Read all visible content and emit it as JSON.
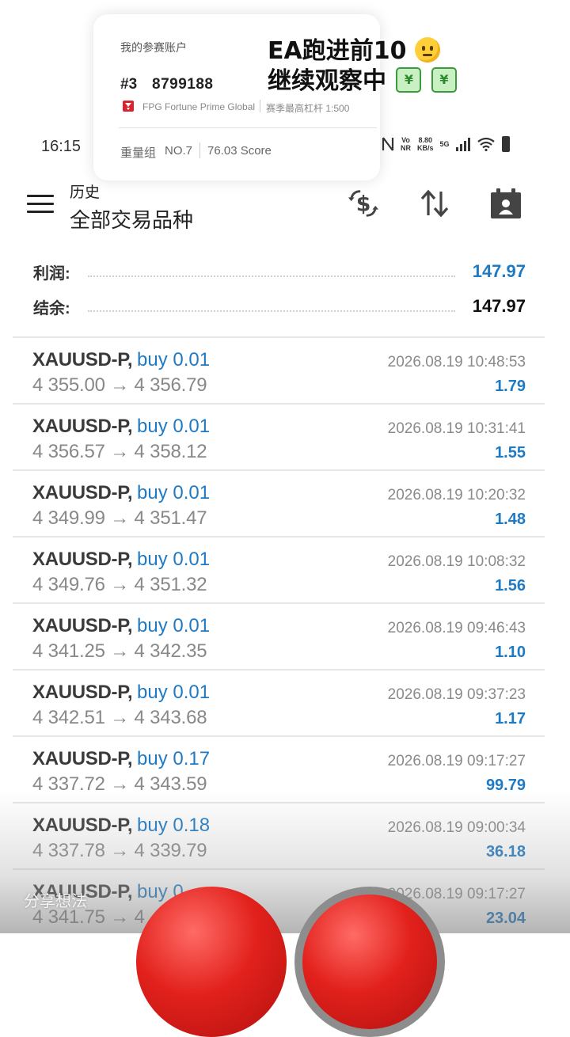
{
  "overlay_card": {
    "label": "我的参赛账户",
    "rank": "#3",
    "account": "8799188",
    "broker": "FPG Fortune Prime Global",
    "leverage": "赛季最高杠杆 1:500",
    "group": "重量组",
    "group_no": "NO.7",
    "score": "76.03 Score"
  },
  "caption": {
    "line1": "EA跑进前10",
    "line2": "继续观察中",
    "chart_glyph": "¥",
    "emoji_face": "saluting-face-icon",
    "emoji_chart": "chart-yen-icon"
  },
  "status_bar": {
    "time": "16:15",
    "net_top": "Vo",
    "net_bottom": "NR",
    "speed_top": "8.80",
    "speed_bottom": "KB/s",
    "network": "5G"
  },
  "header": {
    "subtitle": "历史",
    "title": "全部交易品种",
    "icons": [
      "currency-exchange-icon",
      "sort-icon",
      "calendar-icon"
    ]
  },
  "summary": {
    "profit_label": "利润:",
    "profit_value": "147.97",
    "balance_label": "结余:",
    "balance_value": "147.97",
    "colors": {
      "profit": "#1f7ac4",
      "balance": "#111111"
    }
  },
  "trades": [
    {
      "symbol": "XAUUSD-P,",
      "side": "buy 0.01",
      "prices": "4 355.00 → 4 356.79",
      "time": "2026.08.19 10:48:53",
      "profit": "1.79"
    },
    {
      "symbol": "XAUUSD-P,",
      "side": "buy 0.01",
      "prices": "4 356.57 → 4 358.12",
      "time": "2026.08.19 10:31:41",
      "profit": "1.55"
    },
    {
      "symbol": "XAUUSD-P,",
      "side": "buy 0.01",
      "prices": "4 349.99 → 4 351.47",
      "time": "2026.08.19 10:20:32",
      "profit": "1.48"
    },
    {
      "symbol": "XAUUSD-P,",
      "side": "buy 0.01",
      "prices": "4 349.76 → 4 351.32",
      "time": "2026.08.19 10:08:32",
      "profit": "1.56"
    },
    {
      "symbol": "XAUUSD-P,",
      "side": "buy 0.01",
      "prices": "4 341.25 → 4 342.35",
      "time": "2026.08.19 09:46:43",
      "profit": "1.10"
    },
    {
      "symbol": "XAUUSD-P,",
      "side": "buy 0.01",
      "prices": "4 342.51 → 4 343.68",
      "time": "2026.08.19 09:37:23",
      "profit": "1.17"
    },
    {
      "symbol": "XAUUSD-P,",
      "side": "buy 0.17",
      "prices": "4 337.72 → 4 343.59",
      "time": "2026.08.19 09:17:27",
      "profit": "99.79"
    },
    {
      "symbol": "XAUUSD-P,",
      "side": "buy 0.18",
      "prices": "4 337.78 → 4 339.79",
      "time": "2026.08.19 09:00:34",
      "profit": "36.18"
    },
    {
      "symbol": "XAUUSD-P,",
      "side": "buy 0",
      "prices": "4 341.75 → 4",
      "time": "2026.08.19 09:17:27",
      "profit": "23.04"
    }
  ],
  "bottom": {
    "share_text": "分享想法"
  }
}
